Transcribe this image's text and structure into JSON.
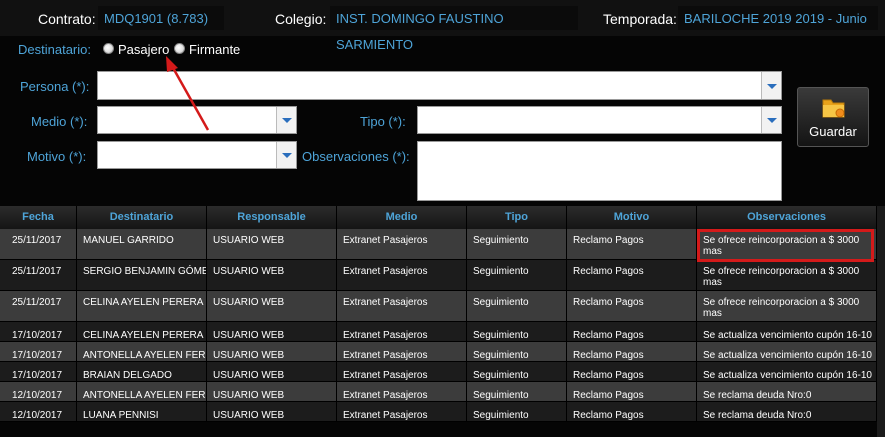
{
  "header": {
    "contrato_label": "Contrato:",
    "contrato_value": "MDQ1901 (8.783)",
    "colegio_label": "Colegio:",
    "colegio_value": "INST. DOMINGO FAUSTINO SARMIENTO",
    "temporada_label": "Temporada:",
    "temporada_value": "BARILOCHE 2019 2019 - Junio"
  },
  "form": {
    "destinatario_label": "Destinatario:",
    "radio_pasajero": "Pasajero",
    "radio_firmante": "Firmante",
    "persona_label": "Persona (*):",
    "medio_label": "Medio (*):",
    "tipo_label": "Tipo (*):",
    "motivo_label": "Motivo (*):",
    "observaciones_label": "Observaciones (*):",
    "persona_value": "",
    "medio_value": "",
    "tipo_value": "",
    "motivo_value": "",
    "observaciones_value": "",
    "save_label": "Guardar",
    "save_icon": "folder-icon"
  },
  "table": {
    "columns": [
      "Fecha",
      "Destinatario",
      "Responsable",
      "Medio",
      "Tipo",
      "Motivo",
      "Observaciones"
    ],
    "rows": [
      [
        "25/11/2017",
        "MANUEL GARRIDO",
        "USUARIO WEB",
        "Extranet Pasajeros",
        "Seguimiento",
        "Reclamo Pagos",
        "Se ofrece reincorporacion a $ 3000 mas"
      ],
      [
        "25/11/2017",
        "SERGIO BENJAMIN  GÓME",
        "USUARIO WEB",
        "Extranet Pasajeros",
        "Seguimiento",
        "Reclamo Pagos",
        "Se ofrece reincorporacion a $ 3000 mas"
      ],
      [
        "25/11/2017",
        "CELINA AYELEN PERERA",
        "USUARIO WEB",
        "Extranet Pasajeros",
        "Seguimiento",
        "Reclamo Pagos",
        "Se ofrece reincorporacion a $ 3000 mas"
      ],
      [
        "17/10/2017",
        "CELINA AYELEN PERERA",
        "USUARIO WEB",
        "Extranet Pasajeros",
        "Seguimiento",
        "Reclamo Pagos",
        "Se actualiza vencimiento cupón 16-10"
      ],
      [
        "17/10/2017",
        "ANTONELLA AYELEN  FERI",
        "USUARIO WEB",
        "Extranet Pasajeros",
        "Seguimiento",
        "Reclamo Pagos",
        "Se actualiza vencimiento cupón 16-10"
      ],
      [
        "17/10/2017",
        "BRAIAN DELGADO",
        "USUARIO WEB",
        "Extranet Pasajeros",
        "Seguimiento",
        "Reclamo Pagos",
        "Se actualiza vencimiento cupón 16-10"
      ],
      [
        "12/10/2017",
        "ANTONELLA AYELEN  FERI",
        "USUARIO WEB",
        "Extranet Pasajeros",
        "Seguimiento",
        "Reclamo Pagos",
        "Se reclama deuda Nro:0"
      ],
      [
        "12/10/2017",
        "LUANA PENNISI",
        "USUARIO WEB",
        "Extranet Pasajeros",
        "Seguimiento",
        "Reclamo Pagos",
        "Se reclama deuda Nro:0"
      ]
    ]
  },
  "colors": {
    "accent": "#4ea4d8",
    "annotation": "#d41a1a"
  }
}
